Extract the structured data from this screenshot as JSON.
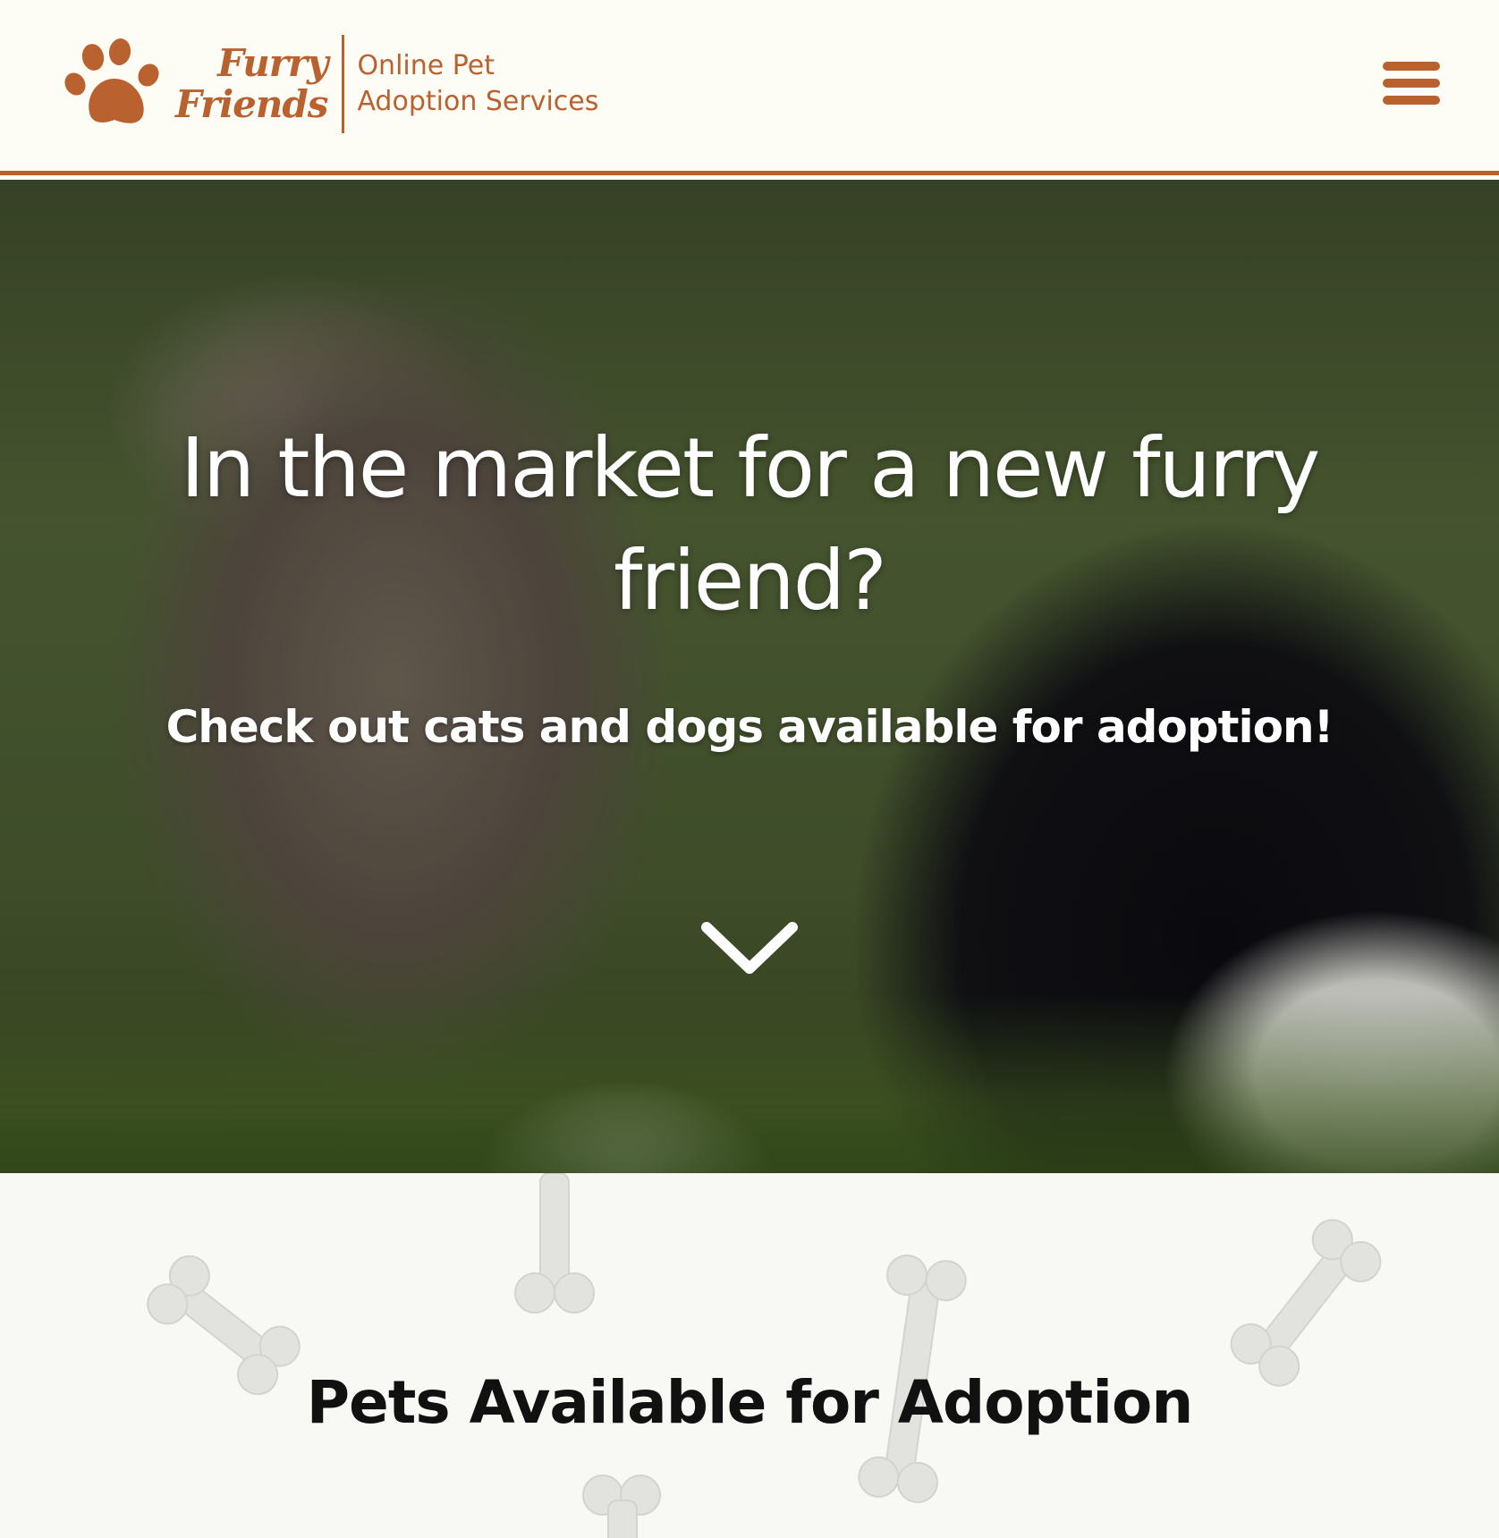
{
  "header": {
    "brand_line1": "Furry",
    "brand_line2": "Friends",
    "tagline_line1": "Online Pet",
    "tagline_line2": "Adoption Services",
    "accent_color": "#b9612f",
    "logo_icon": "paw-icon",
    "menu_icon": "hamburger-menu-icon"
  },
  "hero": {
    "title": "In the market for a new furry friend?",
    "subtitle": "Check out cats and dogs available for adoption!",
    "scroll_icon": "chevron-down-icon"
  },
  "pets_section": {
    "title": "Pets Available for Adoption",
    "decor_icon": "dog-bone-icon"
  }
}
